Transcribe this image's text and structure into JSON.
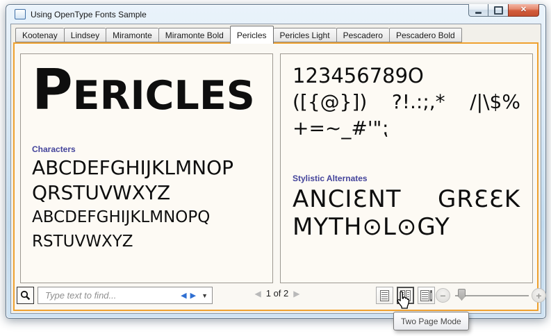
{
  "window": {
    "title": "Using OpenType Fonts Sample"
  },
  "tabs": [
    {
      "label": "Kootenay",
      "selected": false
    },
    {
      "label": "Lindsey",
      "selected": false
    },
    {
      "label": "Miramonte",
      "selected": false
    },
    {
      "label": "Miramonte Bold",
      "selected": false
    },
    {
      "label": "Pericles",
      "selected": true
    },
    {
      "label": "Pericles Light",
      "selected": false
    },
    {
      "label": "Pescadero",
      "selected": false
    },
    {
      "label": "Pescadero Bold",
      "selected": false
    }
  ],
  "left_page": {
    "title_initial": "P",
    "title_rest": "ERICLES",
    "heading": "Characters",
    "caps_line1": "ABCDEFGHIJKLMNOP",
    "caps_line2": "QRSTUVWXYZ",
    "small_line1": "ABCDEFGHIJKLMNOPQ",
    "small_line2": "RSTUVWXYZ"
  },
  "right_page": {
    "numbers": "123456789O",
    "symbols_a": "([{@}])",
    "symbols_b": "?!.:;,*",
    "symbols_c": "/|\\$%",
    "symbols_line2": "+=~_#'\"⁏",
    "heading": "Stylistic Alternates",
    "alt_word1": "ANCIƐNT",
    "alt_word2": "GRƐƐK",
    "alt_line2": "MYTH⊙L⊙GY"
  },
  "toolbar": {
    "search_placeholder": "Type text to find...",
    "page_indicator": "1 of 2"
  },
  "tooltip": {
    "text": "Two Page Mode"
  },
  "icons": {
    "close": "✕",
    "find_prev": "◀",
    "find_next": "▶",
    "find_dropdown": "▼",
    "nav_prev": "◀",
    "nav_next": "▶",
    "zoom_minus": "−",
    "zoom_plus": "+"
  },
  "colors": {
    "accent_orange": "#EFA12F",
    "heading_purple": "#44449B",
    "find_arrow_blue": "#2F6FD2",
    "close_red": "#D25C3C",
    "page_background": "#FDFAF4"
  }
}
